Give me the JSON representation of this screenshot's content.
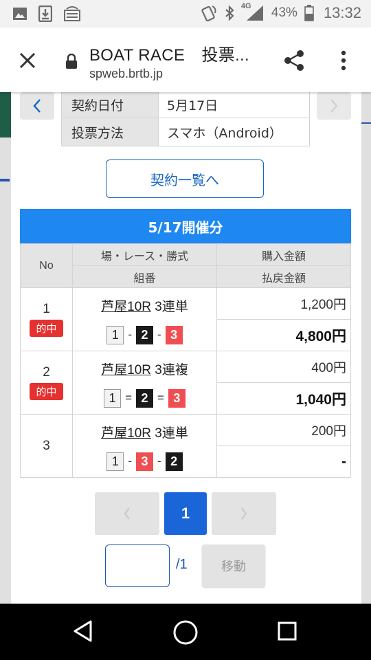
{
  "status_bar": {
    "network": "4G",
    "battery": "43%",
    "time": "13:32"
  },
  "browser": {
    "title": "BOAT RACE　投票...",
    "url": "spweb.brtb.jp"
  },
  "info": {
    "rows": [
      {
        "key": "契約日付",
        "value": "5月17日"
      },
      {
        "key": "投票方法",
        "value": "スマホ（Android）"
      }
    ]
  },
  "contract_list_button": "契約一覧へ",
  "section_title": "5/17開催分",
  "table": {
    "headers": {
      "no": "No",
      "race": "場・レース・勝式",
      "combination": "組番",
      "purchase": "購入金額",
      "payout": "払戻金額"
    },
    "hit_label": "的中",
    "rows": [
      {
        "no": "1",
        "hit": true,
        "venue_race": "芦屋10R",
        "type": "3連単",
        "combo": [
          "1",
          "2",
          "3"
        ],
        "separator": "-",
        "purchase": "1,200円",
        "payout": "4,800円"
      },
      {
        "no": "2",
        "hit": true,
        "venue_race": "芦屋10R",
        "type": "3連複",
        "combo": [
          "1",
          "2",
          "3"
        ],
        "separator": "=",
        "purchase": "400円",
        "payout": "1,040円"
      },
      {
        "no": "3",
        "hit": false,
        "venue_race": "芦屋10R",
        "type": "3連単",
        "combo": [
          "1",
          "3",
          "2"
        ],
        "separator": "-",
        "purchase": "200円",
        "payout": "-"
      }
    ]
  },
  "pagination": {
    "current": "1",
    "total": "/1",
    "move_label": "移動",
    "input_value": ""
  },
  "colors": {
    "accent_blue": "#1e87f0",
    "hit_red": "#e5312f",
    "boat_2": "#1a1a1a",
    "boat_3": "#ef4f52"
  }
}
